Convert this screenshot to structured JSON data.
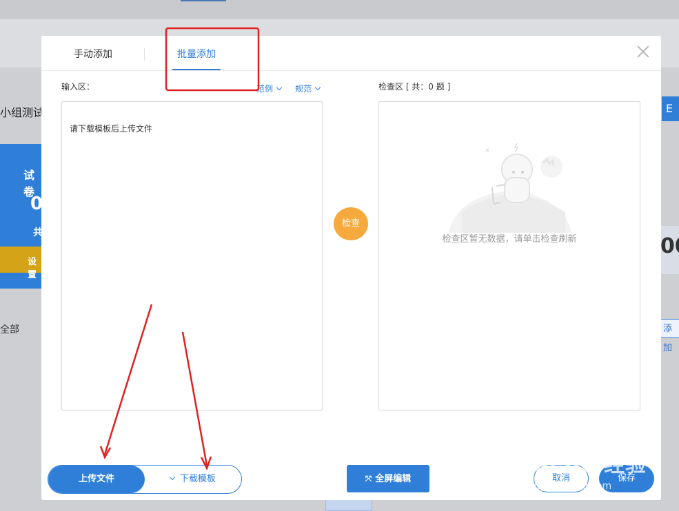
{
  "background": {
    "left_title": "小组测试题",
    "left_card_title": "试卷",
    "left_card_value": "0",
    "left_card_sub": "共",
    "left_card_yellow": "设置",
    "left_filter": "全部",
    "right_button": "E",
    "right_value": "00",
    "right_add": "添加"
  },
  "modal": {
    "tabs": [
      {
        "label": "手动添加",
        "active": false
      },
      {
        "label": "批量添加",
        "active": true
      }
    ],
    "input_label": "输入区：",
    "example_link": "范例",
    "spec_link": "规范",
    "input_placeholder": "请下载模板后上传文件",
    "check_label": "检查区 [ 共：0 题 ]",
    "check_button": "检查",
    "empty_text": "检查区暂无数据，请单击检查刷新",
    "upload_button": "上传文件",
    "download_button": "下载模板",
    "fullscreen_icon": "⤧",
    "fullscreen_button": "全屏编辑",
    "cancel_button": "取消",
    "save_button": "保存"
  },
  "watermark": {
    "main": "Bai du 经验",
    "sub": "jingyan.baidu.com"
  },
  "colors": {
    "accent": "#2f7fd8",
    "check_button": "#f6a93d",
    "annotation": "#e02020"
  }
}
